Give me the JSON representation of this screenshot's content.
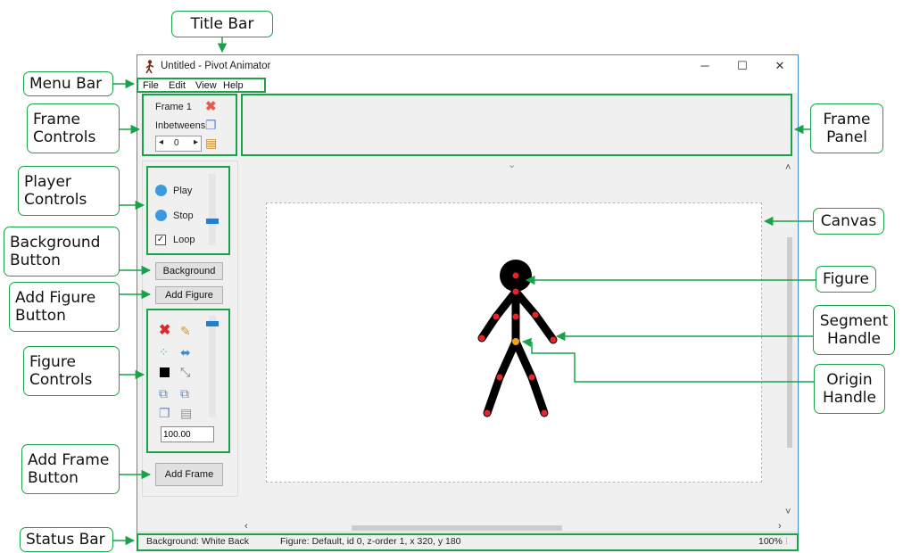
{
  "window": {
    "title": "Untitled - Pivot Animator",
    "controls": {
      "minimize": "─",
      "maximize": "☐",
      "close": "✕"
    }
  },
  "menu": {
    "items": [
      "File",
      "Edit",
      "View",
      "Help"
    ]
  },
  "frame_controls": {
    "frame_label": "Frame 1",
    "inbetweens_label": "Inbetweens",
    "inbetweens_value": "0"
  },
  "player": {
    "play": "Play",
    "stop": "Stop",
    "loop": "Loop",
    "loop_checked": true
  },
  "buttons": {
    "background": "Background",
    "add_figure": "Add Figure",
    "add_frame": "Add Frame"
  },
  "figure_controls": {
    "scale_value": "100.00"
  },
  "status": {
    "background": "Background: White Back",
    "figure": "Figure: Default,  id 0,  z-order 1,  x 320, y 180",
    "zoom": "100%"
  },
  "callouts": {
    "title_bar": "Title Bar",
    "menu_bar": "Menu Bar",
    "frame_controls_1": "Frame",
    "frame_controls_2": "Controls",
    "player_controls_1": "Player",
    "player_controls_2": "Controls",
    "background_button_1": "Background",
    "background_button_2": "Button",
    "add_figure_button_1": "Add Figure",
    "add_figure_button_2": "Button",
    "figure_controls_1": "Figure",
    "figure_controls_2": "Controls",
    "add_frame_button_1": "Add Frame",
    "add_frame_button_2": "Button",
    "status_bar": "Status Bar",
    "frame_panel_1": "Frame",
    "frame_panel_2": "Panel",
    "canvas": "Canvas",
    "figure": "Figure",
    "segment_handle_1": "Segment",
    "segment_handle_2": "Handle",
    "origin_handle_1": "Origin",
    "origin_handle_2": "Handle"
  },
  "colors": {
    "accent": "#1aa24a",
    "handle": "#e2262b",
    "origin": "#f0a21a",
    "window_border": "#3c8ed6"
  }
}
